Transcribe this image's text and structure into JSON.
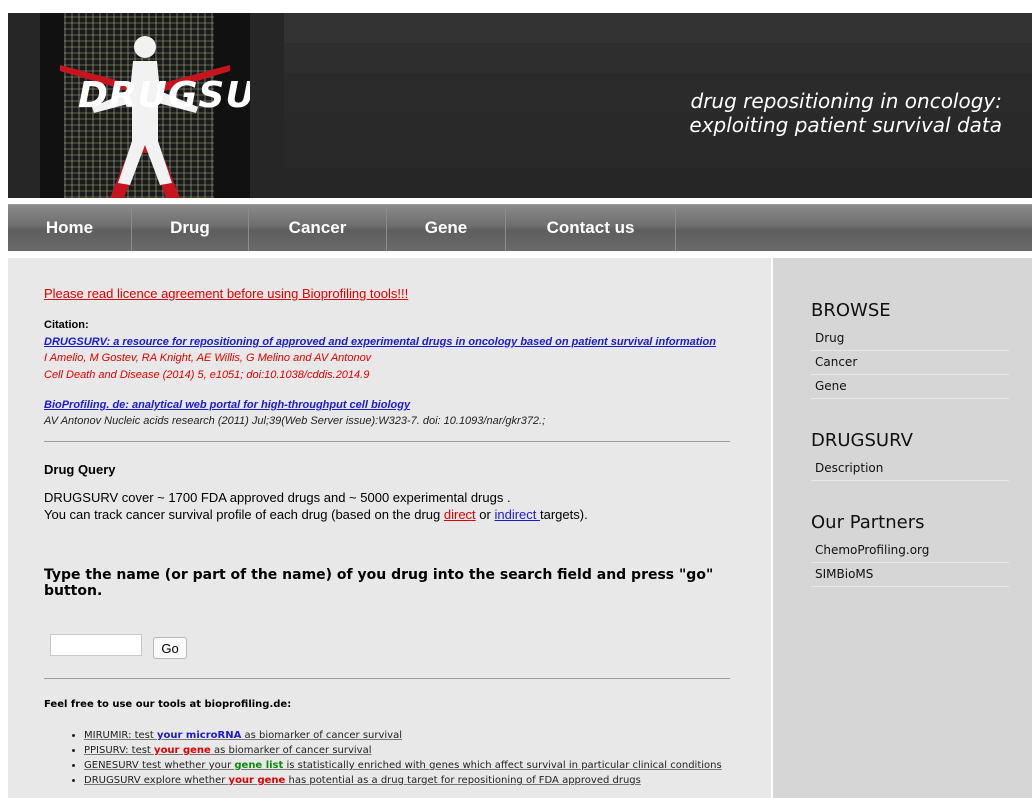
{
  "header": {
    "logo_text": "DRUGSURV",
    "tagline_line1": "drug repositioning in oncology:",
    "tagline_line2": "exploiting patient survival data"
  },
  "nav": {
    "items": [
      "Home",
      "Drug",
      "Cancer",
      "Gene",
      "Contact us"
    ]
  },
  "main": {
    "licence_link": "Please read licence agreement before using Bioprofiling tools!!!",
    "citation_label": "Citation:",
    "paper_title": "DRUGSURV: a resource for repositioning of approved and experimental drugs in oncology based on patient survival information",
    "paper_authors": "I Amelio, M Gostev, RA Knight, AE Willis, G Melino and AV Antonov",
    "paper_journal": "Cell Death and Disease (2014) 5, e1051; doi:10.1038/cddis.2014.9",
    "bio_title": "BioProfiling. de: analytical web portal for high-throughput cell biology",
    "bio_ref": "AV Antonov Nucleic acids research (2011) Jul;39(Web Server issue):W323-7. doi: 10.1093/nar/gkr372.;",
    "drug_query_title": "Drug Query",
    "dq_line1": "DRUGSURV cover ~ 1700 FDA approved drugs and ~ 5000 experimental drugs .",
    "dq_line2_pre": "You can track cancer survival profile of each drug (based on the drug ",
    "dq_direct": "direct",
    "dq_or": " or ",
    "dq_indirect": "indirect ",
    "dq_targets": "targets).",
    "search_prompt": "Type the name (or part of the name) of you drug into the search field and press \"go\" button.",
    "search_value": "",
    "go_label": "Go",
    "tools_title": "Feel free to use our tools at bioprofiling.de:",
    "tools": [
      {
        "pre": "MIRUMIR: test ",
        "kw": "your microRNA",
        "post": " as biomarker of cancer survival"
      },
      {
        "pre": "PPISURV: test ",
        "kw": "your gene",
        "post": " as biomarker of cancer survival"
      },
      {
        "pre": "GENESURV test whether your ",
        "kw": "gene list",
        "post": " is statistically enriched with genes which affect survival in particular clinical conditions"
      },
      {
        "pre": "DRUGSURV explore whether ",
        "kw": "your gene",
        "post": " has potential as a drug target for repositioning of FDA approved drugs"
      }
    ]
  },
  "sidebar": {
    "browse_heading": "BROWSE",
    "browse_items": [
      "Drug",
      "Cancer",
      "Gene"
    ],
    "drugsurv_heading": "DRUGSURV",
    "drugsurv_items": [
      "Description"
    ],
    "partners_heading": "Our Partners",
    "partners_items": [
      "ChemoProfiling.org",
      "SIMBioMS"
    ]
  },
  "colors": {
    "header_bg": "#262626",
    "link_red": "#e00000",
    "link_blue": "#1a1ad6",
    "keyword_green": "#0c8a0c",
    "main_bg": "#e8e8e8",
    "sidebar_bg": "#d6d6d6"
  }
}
